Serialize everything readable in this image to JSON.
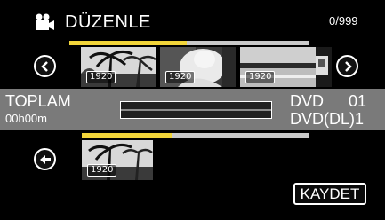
{
  "header": {
    "title": "DÜZENLE",
    "counter": "0/999",
    "icon": "video-camera-icon"
  },
  "strip": {
    "progress_percent": 49,
    "thumbnails": [
      {
        "badge": "1920",
        "scene": "palm-trees"
      },
      {
        "badge": "1920",
        "scene": "portrait"
      },
      {
        "badge": "1920",
        "scene": "lake"
      }
    ],
    "prev_icon": "chevron-left-icon",
    "next_icon": "chevron-right-icon"
  },
  "info": {
    "total_label": "TOPLAM",
    "duration": "00h00m",
    "dvd_label": "DVD",
    "dvd_count": "01",
    "dvd_dl_label": "DVD(DL)1"
  },
  "selection": {
    "progress_percent": 40,
    "thumbnail_badge": "1920",
    "remove_icon": "arrow-left-circle-icon"
  },
  "footer": {
    "save_label": "KAYDET"
  },
  "colors": {
    "background": "#000000",
    "band": "#7a7a7a",
    "progress_fill": "#f2d53a",
    "progress_track": "#c9c9c9"
  }
}
